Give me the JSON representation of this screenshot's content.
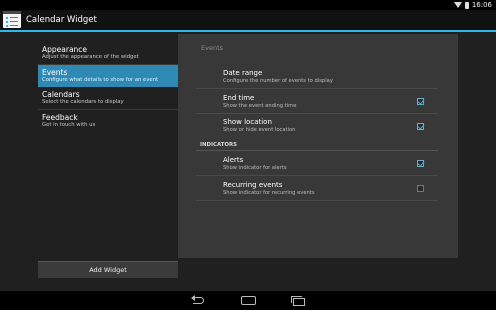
{
  "status_bar": {
    "time": "16:06"
  },
  "app": {
    "title": "Calendar Widget"
  },
  "sidebar": {
    "items": [
      {
        "label": "Appearance",
        "description": "Adjust the appearance of the widget"
      },
      {
        "label": "Events",
        "description": "Configure what details to show for an event"
      },
      {
        "label": "Calendars",
        "description": "Select the calendars to display"
      },
      {
        "label": "Feedback",
        "description": "Get in touch with us"
      }
    ],
    "add_widget_label": "Add Widget"
  },
  "panel": {
    "header": "Events",
    "preferences": [
      {
        "title": "Date range",
        "summary": "Configure the number of events to display"
      },
      {
        "title": "End time",
        "summary": "Show the event ending time",
        "checked": true
      },
      {
        "title": "Show location",
        "summary": "Show or hide event location",
        "checked": true
      }
    ],
    "category": "INDICATORS",
    "indicators": [
      {
        "title": "Alerts",
        "summary": "Show indicator for alerts",
        "checked": true
      },
      {
        "title": "Recurring events",
        "summary": "Show indicator for recurring events",
        "checked": false
      }
    ]
  },
  "colors": {
    "accent": "#33b5e5",
    "selected": "#2e8ab5"
  },
  "icons": [
    "wifi-icon",
    "battery-icon",
    "back-icon",
    "home-icon",
    "recent-apps-icon"
  ]
}
